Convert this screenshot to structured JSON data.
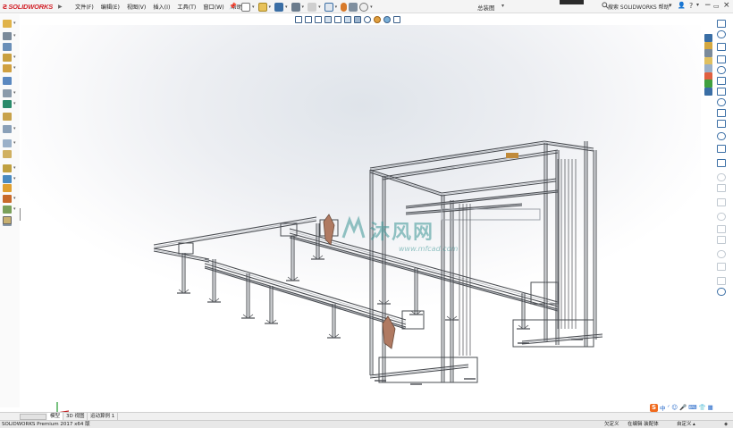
{
  "app": {
    "brand": "SOLIDWORKS",
    "brand_color": "#d2232a",
    "document_title": "总装图",
    "search_placeholder": "搜索 SOLIDWORKS 帮助",
    "help_label": "?"
  },
  "menu": {
    "items": [
      "文件(F)",
      "编辑(E)",
      "视图(V)",
      "插入(I)",
      "工具(T)",
      "窗口(W)",
      "帮助(H)"
    ]
  },
  "tabs": {
    "items": [
      "模型",
      "3D 视图",
      "运动算例 1"
    ],
    "active": "模型"
  },
  "status": {
    "product": "SOLIDWORKS Premium 2017 x64 版",
    "custom": "欠定义",
    "editing": "在编辑 装配体",
    "units": "自定义"
  },
  "watermark": {
    "text": "沐风网",
    "url": "www.mfcad.com"
  },
  "ime": {
    "logo": "S",
    "mode": "中"
  },
  "icons": {
    "logo": "ds-logo-icon",
    "pin": "pin-icon",
    "new": "new-doc-icon",
    "open": "open-icon",
    "save": "save-icon",
    "print": "print-icon",
    "undo": "undo-icon",
    "select": "select-arrow-icon",
    "rebuild": "rebuild-icon",
    "options": "gear-icon",
    "search": "search-icon",
    "user": "user-icon",
    "triad": "coordinate-triad-icon"
  },
  "colors": {
    "frame": "#4a4d52",
    "frame_light": "#9ea3aa",
    "robot": "#b07a62",
    "toolbar_blue": "#3a6ea5"
  }
}
